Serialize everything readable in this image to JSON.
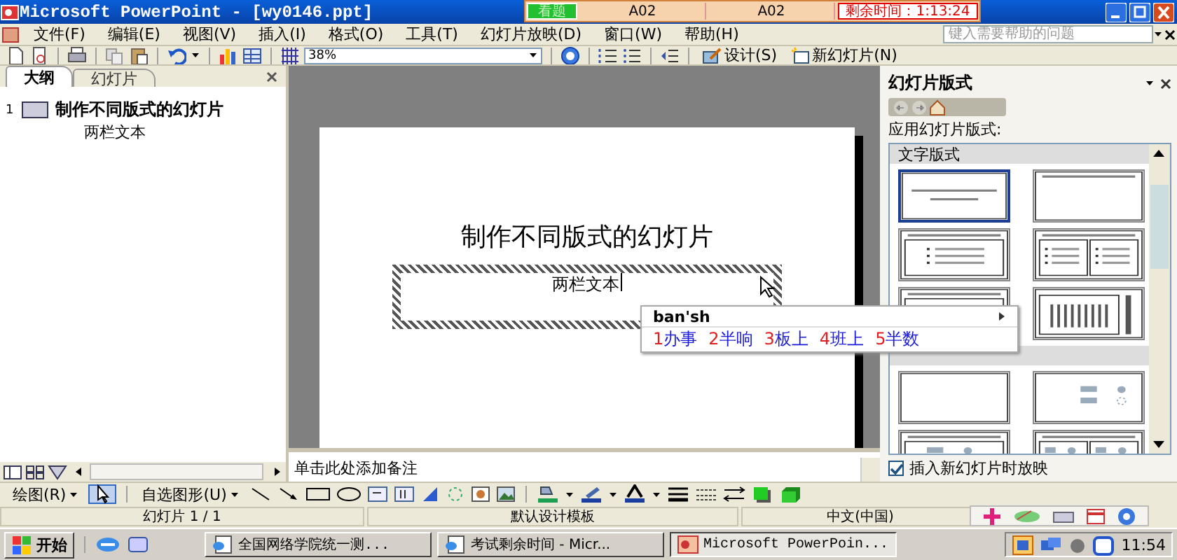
{
  "title_bar": {
    "title": "Microsoft PowerPoint - [wy0146.ppt]"
  },
  "exam_bar": {
    "cells": [
      {
        "text": "看题",
        "kind": "button"
      },
      {
        "text": "A02",
        "kind": "field"
      },
      {
        "text": "A02",
        "kind": "field"
      },
      {
        "text": "剩余时间：1:13:24",
        "kind": "timer"
      }
    ]
  },
  "menu": [
    "文件(F)",
    "编辑(E)",
    "视图(V)",
    "插入(I)",
    "格式(O)",
    "工具(T)",
    "幻灯片放映(D)",
    "窗口(W)",
    "帮助(H)"
  ],
  "help_box": {
    "placeholder": "键入需要帮助的问题"
  },
  "toolbar": {
    "zoom": "38%",
    "buttons": [
      "设计(S)",
      "新幻灯片(N)"
    ]
  },
  "outline_pane": {
    "tabs": [
      {
        "label": "大纲",
        "selected": true
      },
      {
        "label": "幻灯片",
        "selected": false
      }
    ],
    "slides": [
      {
        "number": "1",
        "title": "制作不同版式的幻灯片",
        "children": [
          {
            "text": "两栏文本"
          }
        ]
      }
    ]
  },
  "slide": {
    "title": "制作不同版式的幻灯片",
    "placeholder_text": "两栏文本"
  },
  "notes": {
    "placeholder": "单击此处添加备注"
  },
  "ime": {
    "input": "ban'sh",
    "candidates": [
      {
        "number": "1",
        "text": "办事"
      },
      {
        "number": "2",
        "text": "半响"
      },
      {
        "number": "3",
        "text": "板上"
      },
      {
        "number": "4",
        "text": "班上"
      },
      {
        "number": "5",
        "text": "半数"
      }
    ]
  },
  "task_pane": {
    "title": "幻灯片版式",
    "section": "应用幻灯片版式:",
    "groups": [
      {
        "label": "文字版式",
        "layouts": [
          {
            "kind": "title",
            "selected": true
          },
          {
            "kind": "title-only",
            "selected": false
          },
          {
            "kind": "bullets",
            "selected": false
          },
          {
            "kind": "two-bullets",
            "selected": false
          },
          {
            "kind": "vertical-text",
            "selected": false
          },
          {
            "kind": "vertical-all",
            "selected": false
          }
        ]
      },
      {
        "layouts": [
          {
            "kind": "blank",
            "selected": false
          },
          {
            "kind": "content",
            "selected": false
          },
          {
            "kind": "title-content",
            "selected": false
          },
          {
            "kind": "title-two-content",
            "selected": false
          }
        ]
      }
    ],
    "checkbox": {
      "label": "插入新幻灯片时放映",
      "checked": true
    }
  },
  "drawing_toolbar": {
    "buttons": [
      "绘图(R)",
      "自选图形(U)"
    ]
  },
  "status_bar": [
    "幻灯片 1 / 1",
    "默认设计模板",
    "中文(中国)"
  ],
  "taskbar": {
    "start": "开始",
    "tasks": [
      {
        "label": "全国网络学院统一测...",
        "selected": false
      },
      {
        "label": "考试剩余时间 - Micr...",
        "selected": false
      },
      {
        "label": "Microsoft PowerPoin...",
        "selected": true
      }
    ],
    "clock": "11:54"
  }
}
